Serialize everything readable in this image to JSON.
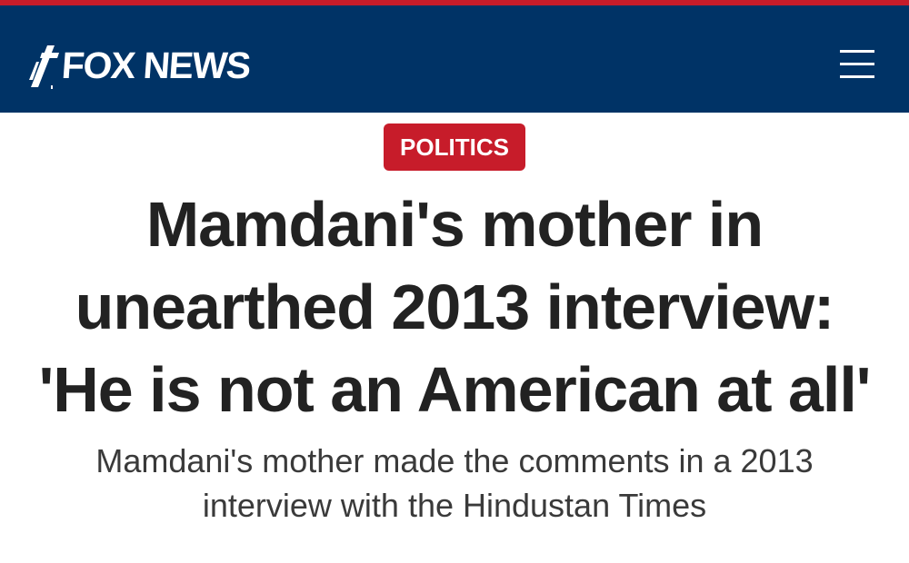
{
  "brand": {
    "name": "FOX NEWS",
    "logo_icon": "fox-news-slash-icon",
    "header_color": "#003366",
    "accent_color": "#c71c2a"
  },
  "header": {
    "menu_icon": "hamburger-menu-icon"
  },
  "article": {
    "category": "POLITICS",
    "headline": "Mamdani's mother in\nunearthed 2013 interview:\n'He is not an American at all'",
    "subheadline": "Mamdani's mother made the comments in a 2013\ninterview with the Hindustan Times"
  }
}
